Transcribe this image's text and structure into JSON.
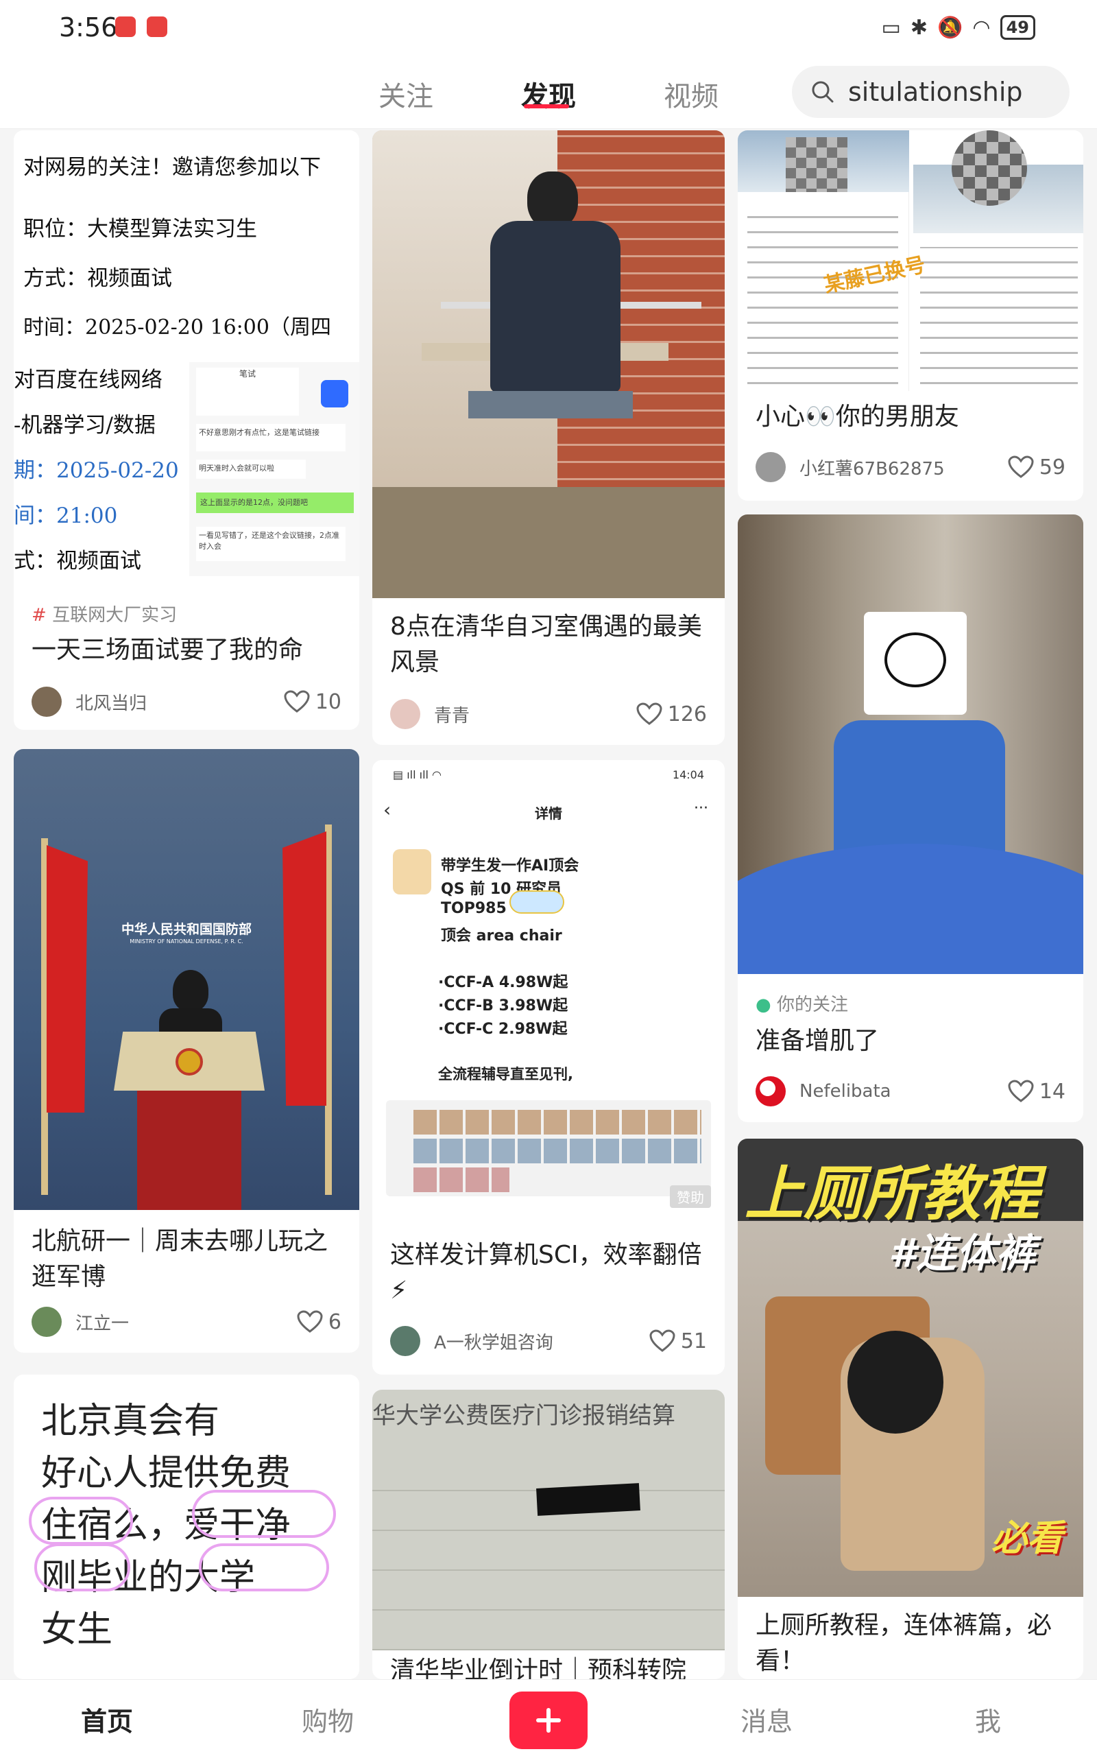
{
  "status": {
    "time": "3:56",
    "battery": "49"
  },
  "topnav": {
    "tabs": [
      "关注",
      "发现",
      "视频"
    ],
    "search_query": "situlationship"
  },
  "feed": {
    "c1": {
      "overlay": [
        "对网易的关注！邀请您参加以下",
        "职位：大模型算法实习生",
        "方式：视频面试",
        "时间：2025-02-20 16:00（周四",
        "对百度在线网络",
        "-机器学习/数据",
        "期：2025-02-20",
        "间：21:00",
        "式：视频面试"
      ],
      "chat": [
        "笔试",
        "不好意思刚才有点忙，这是笔试链接",
        "明天准时入会就可以啦",
        "这上面显示的是12点，没问题吧",
        "一看见写错了，还是这个会议链接，2点准时入会"
      ],
      "tag": "互联网大厂实习",
      "title": "一天三场面试要了我的命",
      "author": "北风当归",
      "likes": "10"
    },
    "c2": {
      "title": "8点在清华自习室偶遇的最美风景",
      "author": "青青",
      "likes": "126"
    },
    "c3": {
      "stamp": "某藤已换号",
      "title": "小心👀你的男朋友",
      "author": "小红薯67B62875",
      "likes": "59"
    },
    "c4": {
      "podium_cn": "中华人民共和国国防部",
      "podium_en": "MINISTRY OF NATIONAL DEFENSE, P. R. C.",
      "title": "北航研一｜周末去哪儿玩之逛军博",
      "author": "江立一",
      "likes": "6"
    },
    "c5": {
      "phone_time": "14:04",
      "header": "详情",
      "lines": [
        "带学生发一作AI顶会",
        "QS 前 10 研究员",
        "TOP985",
        "顶会 area chair",
        "·CCF-A 4.98W起",
        "·CCF-B 3.98W起",
        "·CCF-C 2.98W起",
        "全流程辅导直至见刊,"
      ],
      "badge": "赞助",
      "title": "这样发计算机SCI，效率翻倍⚡",
      "author": "A一秋学姐咨询",
      "likes": "51"
    },
    "c6": {
      "tag": "你的关注",
      "title": "准备增肌了",
      "author": "Nefelibata",
      "likes": "14"
    },
    "c7": {
      "big": [
        "北京真会有",
        "好心人提供免费",
        "住宿么，爱干净",
        "刚毕业的大学",
        "女生"
      ]
    },
    "c8": {
      "doc_title": "华大学公费医疗门诊报销结算",
      "partial": "清华毕业倒计时｜预科转院"
    },
    "c9": {
      "banner": "上厕所教程",
      "hashtag": "#连体裤",
      "sticker": "必看",
      "title": "上厕所教程，连体裤篇，必看！"
    }
  },
  "bottomnav": {
    "items": [
      "首页",
      "购物",
      "消息",
      "我"
    ]
  },
  "colors": {
    "accent": "#ff2442"
  }
}
